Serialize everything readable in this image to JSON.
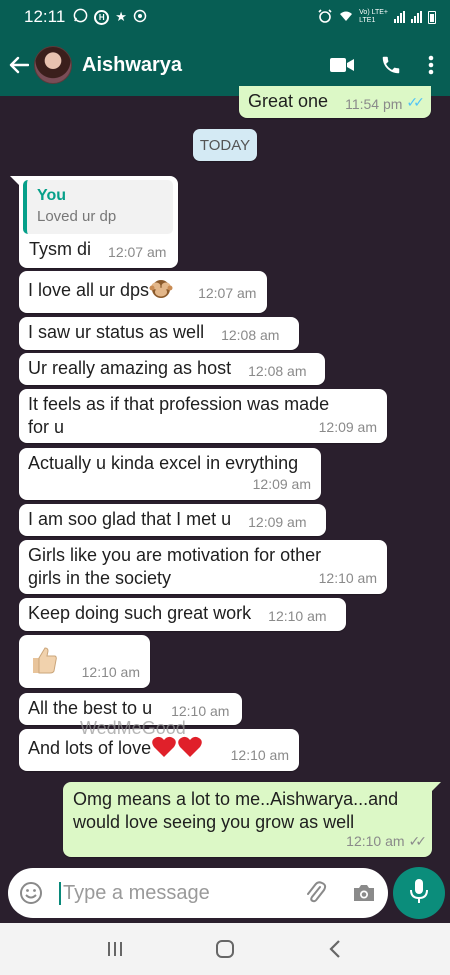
{
  "status_bar": {
    "time": "12:11",
    "network_label": "Vo) LTE+\nLTE1"
  },
  "header": {
    "contact_name": "Aishwarya"
  },
  "chat": {
    "partial_outgoing": {
      "text": "Great one",
      "time": "11:54 pm"
    },
    "date_chip": "TODAY",
    "quoted_reply": {
      "quote_author": "You",
      "quote_text": "Loved ur dp",
      "text": "Tysm di",
      "time": "12:07 am"
    },
    "messages": [
      {
        "text": "I love all ur dps",
        "time": "12:07 am",
        "emoji": "see-no-evil-monkey"
      },
      {
        "text": "I saw ur status as well",
        "time": "12:08 am"
      },
      {
        "text": "Ur really amazing as host",
        "time": "12:08 am"
      },
      {
        "line1": "It feels as if that profession was made",
        "line2": "for u",
        "time": "12:09 am"
      },
      {
        "text": "Actually u kinda excel in evrything",
        "time": "12:09 am"
      },
      {
        "text": "I am soo glad that I met u",
        "time": "12:09 am"
      },
      {
        "line1": "Girls like you are motivation for other",
        "line2": "girls in the society",
        "time": "12:10 am"
      },
      {
        "text": "Keep doing such great work",
        "time": "12:10 am"
      },
      {
        "emoji": "thumbs-up",
        "time": "12:10 am"
      },
      {
        "text": "All the best to u",
        "time": "12:10 am"
      },
      {
        "text": "And lots of love",
        "emoji": "two-red-hearts",
        "time": "12:10 am"
      }
    ],
    "outgoing": {
      "line1": "Omg means a lot to me..Aishwarya...and",
      "line2": "would love seeing you grow as well",
      "time": "12:10 am"
    },
    "watermark": "WedMeGood"
  },
  "composer": {
    "placeholder": "Type a message"
  },
  "colors": {
    "header": "#075e54",
    "chat_background": "#2a1f2d",
    "incoming_bubble": "#ffffff",
    "outgoing_bubble": "#dcf8c6",
    "read_ticks": "#4fc3f7",
    "mic_button": "#0b8d7b"
  }
}
